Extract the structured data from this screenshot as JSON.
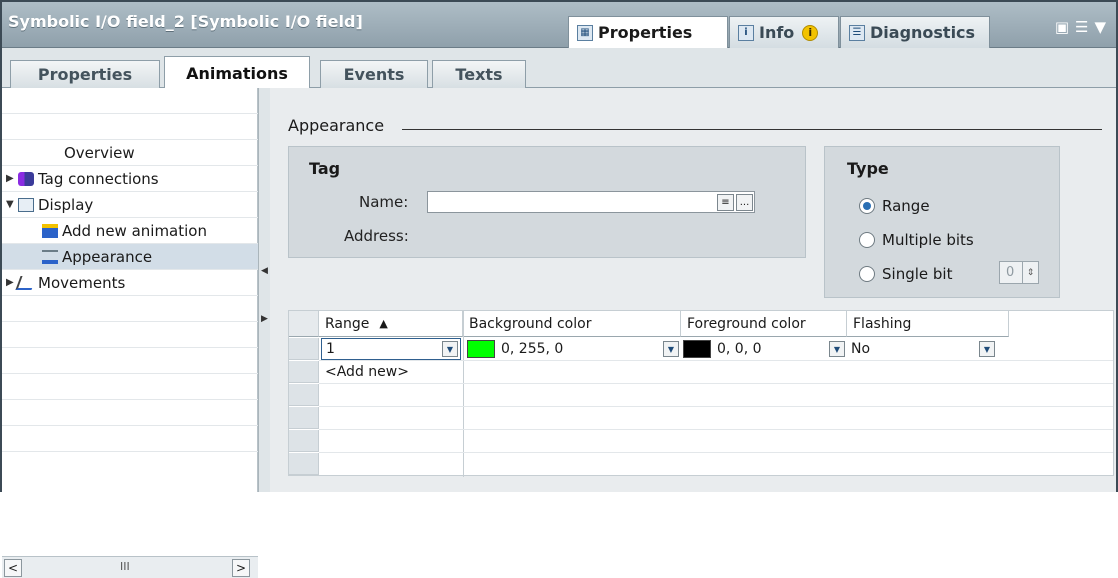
{
  "window": {
    "title": "Symbolic I/O field_2 [Symbolic I/O field]",
    "tabs": [
      {
        "label": "Properties",
        "icon": "properties-icon"
      },
      {
        "label": "Info",
        "icon": "info-icon",
        "badge": "i"
      },
      {
        "label": "Diagnostics",
        "icon": "diagnostics-icon"
      }
    ]
  },
  "subtabs": [
    "Properties",
    "Animations",
    "Events",
    "Texts"
  ],
  "tree": {
    "items": [
      {
        "label": "Overview",
        "icon": "",
        "arrow": ""
      },
      {
        "label": "Tag connections",
        "icon": "tag-connections-icon",
        "arrow": "▶"
      },
      {
        "label": "Display",
        "icon": "display-icon",
        "arrow": "▼"
      },
      {
        "label": "Add new animation",
        "icon": "add-animation-icon",
        "arrow": ""
      },
      {
        "label": "Appearance",
        "icon": "appearance-icon",
        "arrow": ""
      },
      {
        "label": "Movements",
        "icon": "movements-icon",
        "arrow": "▶"
      }
    ],
    "scroll_left": "<",
    "scroll_grip": "III",
    "scroll_right": ">"
  },
  "appearance": {
    "section_title": "Appearance",
    "tag": {
      "title": "Tag",
      "name_label": "Name:",
      "name_value": "",
      "address_label": "Address:",
      "browse_label": "..."
    },
    "type": {
      "title": "Type",
      "options": [
        "Range",
        "Multiple bits",
        "Single bit"
      ],
      "selected": "Range",
      "bit_value": "0"
    },
    "grid": {
      "columns": [
        "Range",
        "Background color",
        "Foreground color",
        "Flashing"
      ],
      "sort_indicator": "▲",
      "rows": [
        {
          "range": "1",
          "background": "0, 255, 0",
          "background_color": "#00ff00",
          "foreground": "0, 0, 0",
          "foreground_color": "#000000",
          "flashing": "No"
        }
      ],
      "add_new": "<Add new>"
    }
  }
}
